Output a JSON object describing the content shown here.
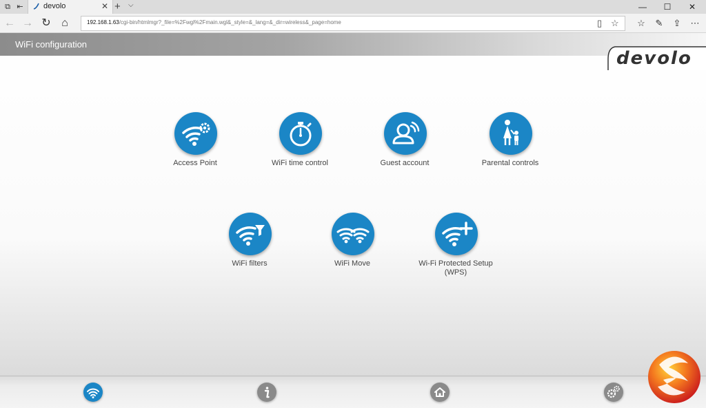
{
  "browser": {
    "tab_title": "devolo",
    "url_host": "192.168.1.63",
    "url_path": "/cgi-bin/htmlmgr?_file=%2Fwgl%2Fmain.wgl&_style=&_lang=&_dir=wireless&_page=home",
    "more_label": "⋯"
  },
  "header": {
    "title": "WiFi configuration",
    "logo": "devolo"
  },
  "tiles": [
    {
      "label": "Access Point",
      "icon": "wifi-gear-icon"
    },
    {
      "label": "WiFi time control",
      "icon": "stopwatch-icon"
    },
    {
      "label": "Guest account",
      "icon": "guest-user-icon"
    },
    {
      "label": "Parental controls",
      "icon": "parent-child-icon"
    },
    {
      "label": "WiFi filters",
      "icon": "wifi-filter-icon"
    },
    {
      "label": "WiFi Move",
      "icon": "double-wifi-icon"
    },
    {
      "label": "Wi-Fi Protected Setup (WPS)",
      "icon": "wifi-plus-icon"
    }
  ],
  "footer": {
    "items": [
      {
        "icon": "wifi-icon",
        "active": true
      },
      {
        "icon": "info-icon",
        "active": false
      },
      {
        "icon": "home-icon",
        "active": false
      },
      {
        "icon": "gears-icon",
        "active": false
      }
    ]
  },
  "colors": {
    "accent": "#1b86c6",
    "idle": "#8a8a8a"
  }
}
